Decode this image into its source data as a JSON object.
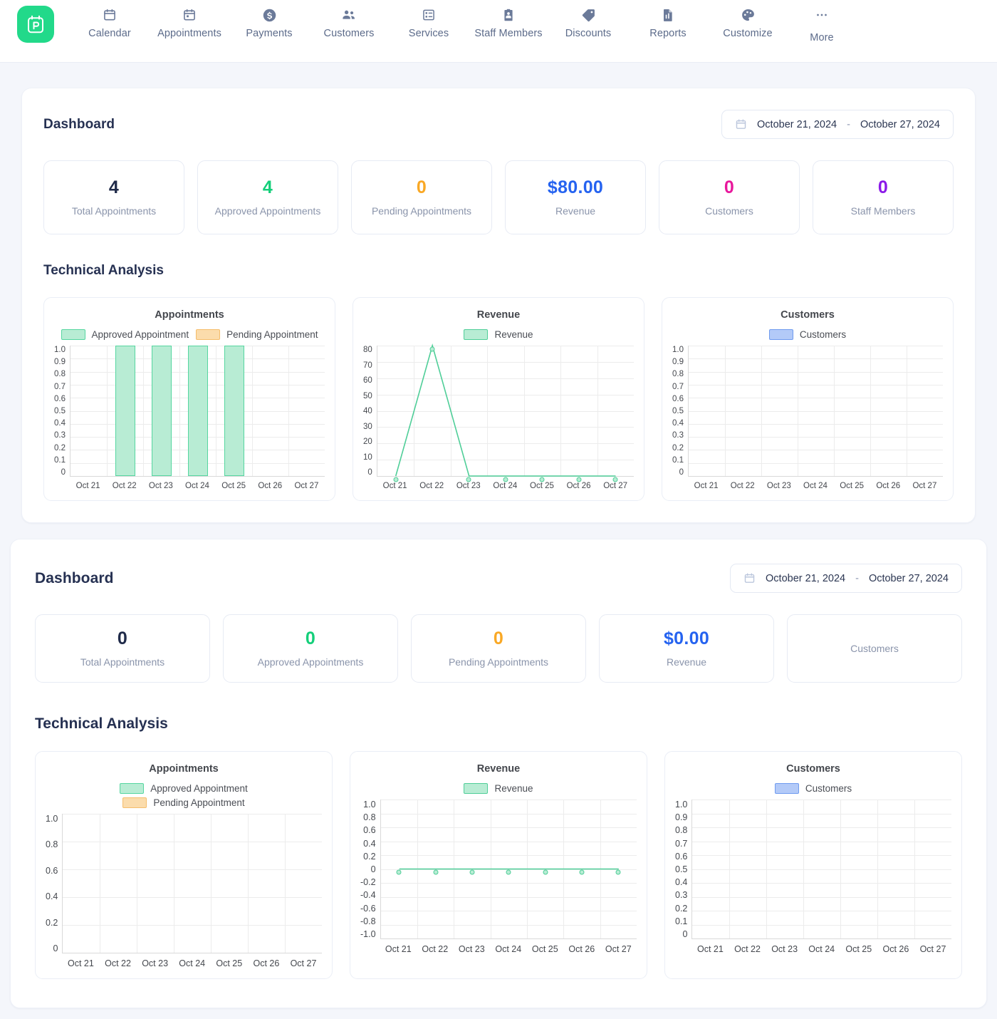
{
  "app": {
    "logo_icon": "calendar-p-logo-icon",
    "brand_color": "#22d98a"
  },
  "nav": {
    "items": [
      {
        "label": "Calendar",
        "icon": "calendar-icon"
      },
      {
        "label": "Appointments",
        "icon": "calendar-event-icon"
      },
      {
        "label": "Payments",
        "icon": "dollar-circle-icon"
      },
      {
        "label": "Customers",
        "icon": "users-icon"
      },
      {
        "label": "Services",
        "icon": "list-card-icon"
      },
      {
        "label": "Staff Members",
        "icon": "id-badge-icon"
      },
      {
        "label": "Discounts",
        "icon": "tag-icon"
      },
      {
        "label": "Reports",
        "icon": "document-chart-icon"
      },
      {
        "label": "Customize",
        "icon": "palette-icon"
      },
      {
        "label": "More",
        "icon": "ellipsis-icon"
      }
    ]
  },
  "panel1": {
    "title": "Dashboard",
    "daterange": {
      "icon": "calendar-icon",
      "start": "October 21, 2024",
      "dash": "-",
      "end": "October 27, 2024"
    },
    "stats": [
      {
        "value": "4",
        "label": "Total Appointments",
        "color": "#1f2a49"
      },
      {
        "value": "4",
        "label": "Approved Appointments",
        "color": "#14cf7a"
      },
      {
        "value": "0",
        "label": "Pending Appointments",
        "color": "#f9a825"
      },
      {
        "value": "$80.00",
        "label": "Revenue",
        "color": "#2563f0"
      },
      {
        "value": "0",
        "label": "Customers",
        "color": "#e8189c"
      },
      {
        "value": "0",
        "label": "Staff Members",
        "color": "#8b1ae8"
      }
    ],
    "technical_analysis_title": "Technical Analysis"
  },
  "panel2": {
    "title": "Dashboard",
    "daterange": {
      "icon": "calendar-icon",
      "start": "October 21, 2024",
      "dash": "-",
      "end": "October 27, 2024"
    },
    "stats": [
      {
        "value": "0",
        "label": "Total Appointments",
        "color": "#1f2a49"
      },
      {
        "value": "0",
        "label": "Approved Appointments",
        "color": "#14cf7a"
      },
      {
        "value": "0",
        "label": "Pending Appointments",
        "color": "#f9a825"
      },
      {
        "value": "$0.00",
        "label": "Revenue",
        "color": "#2563f0"
      },
      {
        "value": "",
        "label": "Customers",
        "color": "#1f2a49"
      }
    ],
    "technical_analysis_title": "Technical Analysis"
  },
  "chart_data": [
    {
      "id": "p1-appointments",
      "type": "bar",
      "title": "Appointments",
      "categories": [
        "Oct 21",
        "Oct 22",
        "Oct 23",
        "Oct 24",
        "Oct 25",
        "Oct 26",
        "Oct 27"
      ],
      "series": [
        {
          "name": "Approved Appointment",
          "values": [
            0,
            1,
            1,
            1,
            1,
            0,
            0
          ],
          "fill": "#b8ecd4",
          "stroke": "#56d6a0"
        },
        {
          "name": "Pending Appointment",
          "values": [
            0,
            0,
            0,
            0,
            0,
            0,
            0
          ],
          "fill": "#fbdcac",
          "stroke": "#f5bd6b"
        }
      ],
      "ylim": [
        0,
        1.0
      ],
      "yticks": [
        "1.0",
        "0.9",
        "0.8",
        "0.7",
        "0.6",
        "0.5",
        "0.4",
        "0.3",
        "0.2",
        "0.1",
        "0"
      ],
      "xlabel": "",
      "ylabel": "",
      "grid": true,
      "legend_position": "top",
      "legend_layout": "inline"
    },
    {
      "id": "p1-revenue",
      "type": "line",
      "title": "Revenue",
      "categories": [
        "Oct 21",
        "Oct 22",
        "Oct 23",
        "Oct 24",
        "Oct 25",
        "Oct 26",
        "Oct 27"
      ],
      "series": [
        {
          "name": "Revenue",
          "values": [
            0,
            80,
            0,
            0,
            0,
            0,
            0
          ],
          "fill": "#b8ecd4",
          "stroke": "#4fce98"
        }
      ],
      "ylim": [
        0,
        80
      ],
      "yticks": [
        "80",
        "70",
        "60",
        "50",
        "40",
        "30",
        "20",
        "10",
        "0"
      ],
      "xlabel": "",
      "ylabel": "",
      "grid": true,
      "legend_position": "top",
      "legend_layout": "inline"
    },
    {
      "id": "p1-customers",
      "type": "line",
      "title": "Customers",
      "categories": [
        "Oct 21",
        "Oct 22",
        "Oct 23",
        "Oct 24",
        "Oct 25",
        "Oct 26",
        "Oct 27"
      ],
      "series": [
        {
          "name": "Customers",
          "values": [],
          "fill": "#b3caf8",
          "stroke": "#6f9bef"
        }
      ],
      "ylim": [
        0,
        1.0
      ],
      "yticks": [
        "1.0",
        "0.9",
        "0.8",
        "0.7",
        "0.6",
        "0.5",
        "0.4",
        "0.3",
        "0.2",
        "0.1",
        "0"
      ],
      "xlabel": "",
      "ylabel": "",
      "grid": true,
      "legend_position": "top",
      "legend_layout": "inline"
    },
    {
      "id": "p2-appointments",
      "type": "bar",
      "title": "Appointments",
      "categories": [
        "Oct 21",
        "Oct 22",
        "Oct 23",
        "Oct 24",
        "Oct 25",
        "Oct 26",
        "Oct 27"
      ],
      "series": [
        {
          "name": "Approved Appointment",
          "values": [
            0,
            0,
            0,
            0,
            0,
            0,
            0
          ],
          "fill": "#b8ecd4",
          "stroke": "#56d6a0"
        },
        {
          "name": "Pending Appointment",
          "values": [
            0,
            0,
            0,
            0,
            0,
            0,
            0
          ],
          "fill": "#fbdcac",
          "stroke": "#f5bd6b"
        }
      ],
      "ylim": [
        0,
        1.0
      ],
      "yticks": [
        "1.0",
        "0.8",
        "0.6",
        "0.4",
        "0.2",
        "0"
      ],
      "xlabel": "",
      "ylabel": "",
      "grid": true,
      "legend_position": "top",
      "legend_layout": "stacked"
    },
    {
      "id": "p2-revenue",
      "type": "line",
      "title": "Revenue",
      "categories": [
        "Oct 21",
        "Oct 22",
        "Oct 23",
        "Oct 24",
        "Oct 25",
        "Oct 26",
        "Oct 27"
      ],
      "series": [
        {
          "name": "Revenue",
          "values": [
            0,
            0,
            0,
            0,
            0,
            0,
            0
          ],
          "fill": "#b8ecd4",
          "stroke": "#4fce98"
        }
      ],
      "ylim": [
        -1.0,
        1.0
      ],
      "yticks": [
        "1.0",
        "0.8",
        "0.6",
        "0.4",
        "0.2",
        "0",
        "-0.2",
        "-0.4",
        "-0.6",
        "-0.8",
        "-1.0"
      ],
      "xlabel": "",
      "ylabel": "",
      "grid": true,
      "legend_position": "top",
      "legend_layout": "inline"
    },
    {
      "id": "p2-customers",
      "type": "line",
      "title": "Customers",
      "categories": [
        "Oct 21",
        "Oct 22",
        "Oct 23",
        "Oct 24",
        "Oct 25",
        "Oct 26",
        "Oct 27"
      ],
      "series": [
        {
          "name": "Customers",
          "values": [],
          "fill": "#b3caf8",
          "stroke": "#6f9bef"
        }
      ],
      "ylim": [
        0,
        1.0
      ],
      "yticks": [
        "1.0",
        "0.9",
        "0.8",
        "0.7",
        "0.6",
        "0.5",
        "0.4",
        "0.3",
        "0.2",
        "0.1",
        "0"
      ],
      "xlabel": "",
      "ylabel": "",
      "grid": true,
      "legend_position": "top",
      "legend_layout": "inline"
    }
  ]
}
